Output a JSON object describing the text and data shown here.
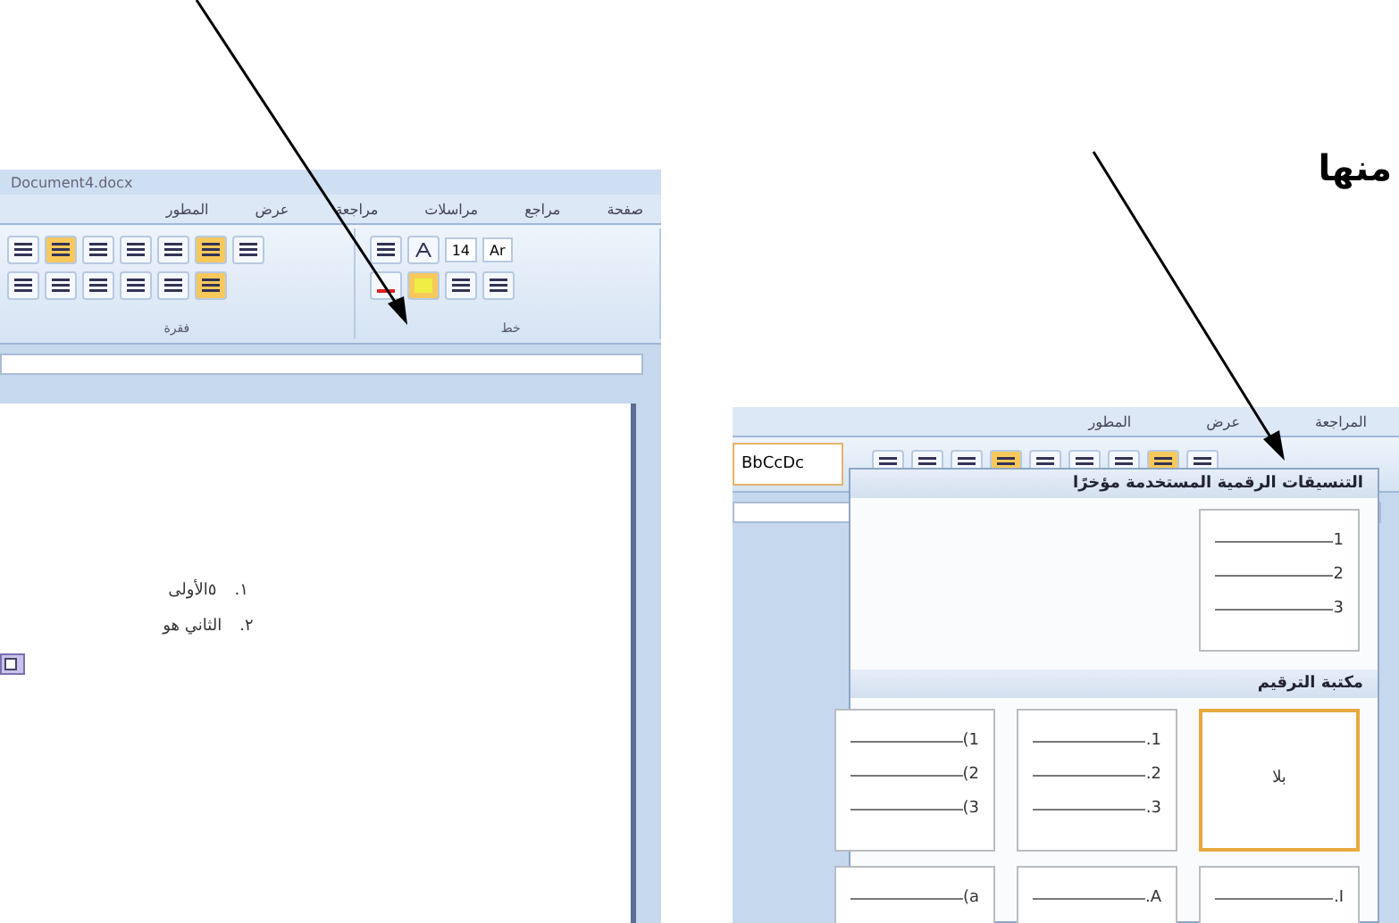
{
  "caption": "منها",
  "left_window": {
    "title": "Document4.docx",
    "tabs": [
      {
        "label": "صفحة",
        "selected": false
      },
      {
        "label": "مراجع",
        "selected": false
      },
      {
        "label": "مراسلات",
        "selected": false
      },
      {
        "label": "مراجعة",
        "selected": false
      },
      {
        "label": "عرض",
        "selected": false
      },
      {
        "label": "المطور",
        "selected": false
      }
    ],
    "font_size": "14",
    "font_name": "Ar",
    "groups": [
      {
        "kind": "font",
        "label": "خط"
      },
      {
        "kind": "paragraph",
        "label": "فقرة"
      }
    ],
    "list": [
      {
        "number": "١.",
        "text": "٥الأولى"
      },
      {
        "number": "٢.",
        "text": "الثاني هو"
      }
    ]
  },
  "right_window": {
    "tabs": [
      {
        "label": "المراجعة",
        "selected": false
      },
      {
        "label": "عرض",
        "selected": false
      },
      {
        "label": "المطور",
        "selected": false
      }
    ],
    "style_preview": "BbCcDc",
    "menu": {
      "sections": [
        {
          "title": "التنسيقات الرقمية المستخدمة مؤخرًا",
          "tiles": [
            {
              "kind": "list",
              "lines": [
                "1",
                "2",
                "3"
              ],
              "selected": false
            }
          ]
        },
        {
          "title": "مكتبة الترقيم",
          "tiles": [
            {
              "kind": "none",
              "label": "بلا",
              "selected": true
            },
            {
              "kind": "list",
              "lines": [
                ".1",
                ".2",
                ".3"
              ],
              "selected": false
            },
            {
              "kind": "list",
              "lines": [
                "(1",
                "(2",
                "(3"
              ],
              "selected": false
            },
            {
              "kind": "list",
              "lines": [
                ".I"
              ],
              "selected": false
            },
            {
              "kind": "list",
              "lines": [
                ".A"
              ],
              "selected": false
            },
            {
              "kind": "list",
              "lines": [
                "(a"
              ],
              "selected": false
            }
          ]
        }
      ]
    }
  }
}
